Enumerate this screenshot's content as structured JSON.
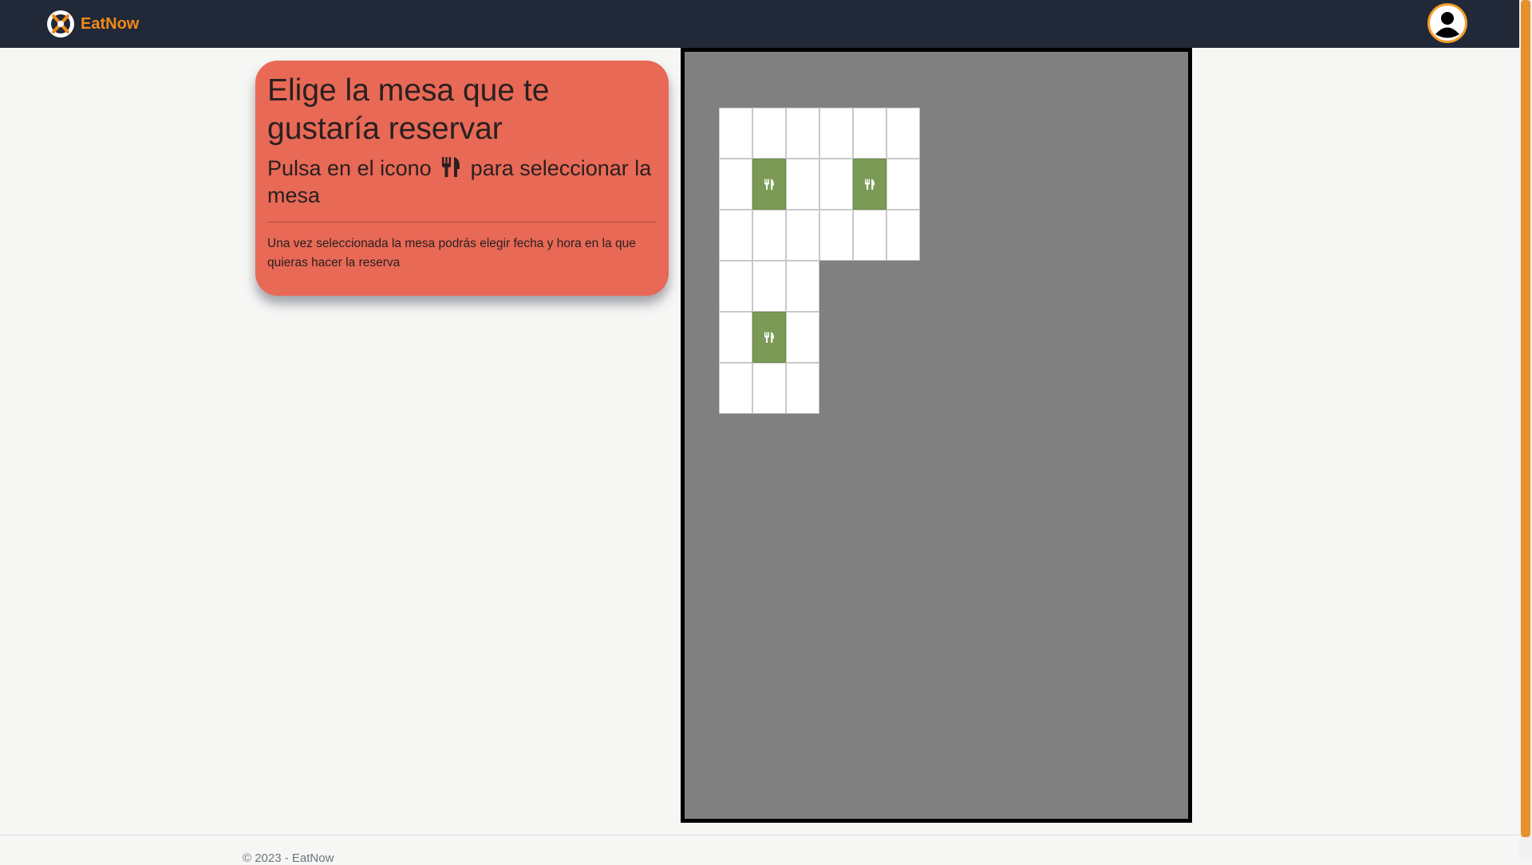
{
  "header": {
    "brand_name": "EatNow",
    "brand_color": "#f08a18",
    "nav_background": "#212838",
    "logo_icon": "eatnow-logo-icon",
    "user_icon": "user-avatar-icon"
  },
  "info_card": {
    "title": "Elige la mesa que te gustaría reservar",
    "subtitle_before": "Pulsa en el icono",
    "subtitle_icon": "utensils-icon",
    "subtitle_after": "para seleccionar la mesa",
    "note": "Una vez seleccionada la mesa podrás elegir fecha y hora en la que quieras hacer la reserva",
    "background": "#e86956"
  },
  "floor_plan": {
    "grid_columns": 6,
    "grid_rows": 6,
    "cells": [
      {
        "row": 0,
        "col": 0,
        "type": "floor"
      },
      {
        "row": 0,
        "col": 1,
        "type": "floor"
      },
      {
        "row": 0,
        "col": 2,
        "type": "floor"
      },
      {
        "row": 0,
        "col": 3,
        "type": "floor"
      },
      {
        "row": 0,
        "col": 4,
        "type": "floor"
      },
      {
        "row": 0,
        "col": 5,
        "type": "floor"
      },
      {
        "row": 1,
        "col": 0,
        "type": "floor"
      },
      {
        "row": 1,
        "col": 1,
        "type": "table",
        "icon": "utensils-icon"
      },
      {
        "row": 1,
        "col": 2,
        "type": "floor"
      },
      {
        "row": 1,
        "col": 3,
        "type": "floor"
      },
      {
        "row": 1,
        "col": 4,
        "type": "table",
        "icon": "utensils-icon"
      },
      {
        "row": 1,
        "col": 5,
        "type": "floor"
      },
      {
        "row": 2,
        "col": 0,
        "type": "floor"
      },
      {
        "row": 2,
        "col": 1,
        "type": "floor"
      },
      {
        "row": 2,
        "col": 2,
        "type": "floor"
      },
      {
        "row": 2,
        "col": 3,
        "type": "floor"
      },
      {
        "row": 2,
        "col": 4,
        "type": "floor"
      },
      {
        "row": 2,
        "col": 5,
        "type": "floor"
      },
      {
        "row": 3,
        "col": 0,
        "type": "floor"
      },
      {
        "row": 3,
        "col": 1,
        "type": "floor"
      },
      {
        "row": 3,
        "col": 2,
        "type": "floor"
      },
      {
        "row": 4,
        "col": 0,
        "type": "floor"
      },
      {
        "row": 4,
        "col": 1,
        "type": "table",
        "icon": "utensils-icon"
      },
      {
        "row": 4,
        "col": 2,
        "type": "floor"
      },
      {
        "row": 5,
        "col": 0,
        "type": "floor"
      },
      {
        "row": 5,
        "col": 1,
        "type": "floor"
      },
      {
        "row": 5,
        "col": 2,
        "type": "floor"
      }
    ],
    "table_color": "#7a9a55",
    "floor_color": "#ffffff",
    "background": "#808080"
  },
  "footer": {
    "text": "© 2023 - EatNow"
  }
}
